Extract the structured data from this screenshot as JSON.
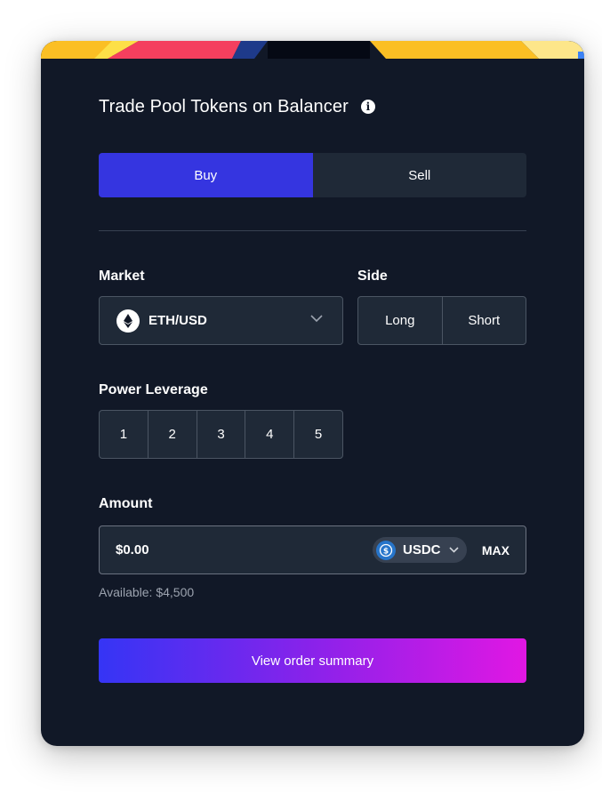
{
  "header": {
    "title": "Trade Pool Tokens on Balancer",
    "info_icon": "info-icon"
  },
  "trade_tabs": {
    "buy_label": "Buy",
    "sell_label": "Sell",
    "selected": "Buy"
  },
  "market": {
    "label": "Market",
    "value": "ETH/USD",
    "icon": "ethereum-icon"
  },
  "side": {
    "label": "Side",
    "options": [
      "Long",
      "Short"
    ]
  },
  "leverage": {
    "label": "Power Leverage",
    "options": [
      "1",
      "2",
      "3",
      "4",
      "5"
    ]
  },
  "amount": {
    "label": "Amount",
    "placeholder": "$0.00",
    "token": "USDC",
    "token_icon": "usdc-icon",
    "max_label": "MAX",
    "available_text": "Available: $4,500"
  },
  "cta": {
    "label": "View order summary"
  },
  "colors": {
    "card_bg": "#111827",
    "active_tab": "#3535e0",
    "input_bg": "#1f2937",
    "border": "#4b5563",
    "gradient_start": "#3535f5",
    "gradient_end": "#e117e3"
  }
}
